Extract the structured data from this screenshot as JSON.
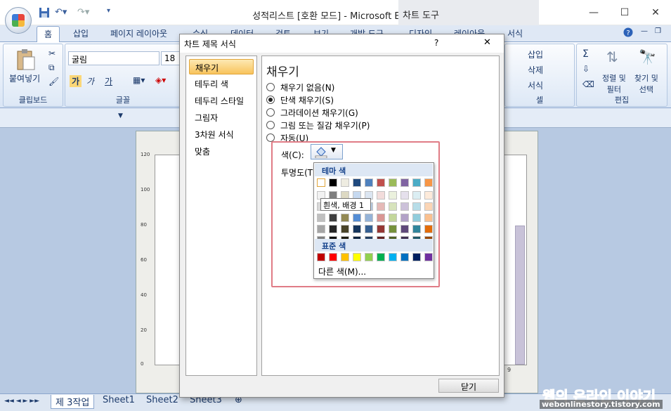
{
  "window": {
    "title": "성적리스트  [호환 모드] - Microsoft Excel",
    "chart_tools_label": "차트 도구",
    "controls": [
      "—",
      "☐",
      "✕"
    ]
  },
  "qat": {
    "more_label": "▾"
  },
  "ribbon_tabs": [
    "홈",
    "삽입",
    "페이지 레이아웃",
    "수식",
    "데이터",
    "검토",
    "보기",
    "개발 도구",
    "디자인",
    "레이아웃",
    "서식"
  ],
  "ribbon": {
    "clipboard": {
      "paste_label": "붙여넣기",
      "group_label": "클립보드"
    },
    "font": {
      "font_name": "굴림",
      "font_size": "18",
      "group_label": "글꼴",
      "bold": "가",
      "italic": "가",
      "underline": "가"
    },
    "cells": {
      "insert": "삽입",
      "delete": "삭제",
      "format": "서식",
      "group_label": "셀"
    },
    "editing": {
      "sum": "Σ",
      "sort_filter": "정렬 및\n필터",
      "find_select": "찾기 및\n선택",
      "group_label": "편집"
    }
  },
  "chart": {
    "y_ticks": [
      "120",
      "100",
      "80",
      "60",
      "40",
      "20",
      "0"
    ],
    "last_category": "9"
  },
  "sheet_tabs": [
    "제 3작업",
    "Sheet1",
    "Sheet2",
    "Sheet3"
  ],
  "dialog": {
    "title": "차트 제목 서식",
    "help": "?",
    "close_x": "✕",
    "nav_items": [
      "채우기",
      "테두리 색",
      "테두리 스타일",
      "그림자",
      "3차원 서식",
      "맞춤"
    ],
    "selected_nav": "채우기",
    "section_title": "채우기",
    "fill_options": [
      "채우기 없음(N)",
      "단색 채우기(S)",
      "그라데이션 채우기(G)",
      "그림 또는 질감 채우기(P)",
      "자동(U)"
    ],
    "selected_fill": "단색 채우기(S)",
    "color_label": "색(C):",
    "transparency_label": "투명도(T",
    "close_button": "닫기"
  },
  "palette": {
    "theme_header": "테마 색",
    "standard_header": "표준 색",
    "more_colors": "다른 색(M)...",
    "tooltip": "흰색, 배경 1",
    "theme_colors": [
      "#ffffff",
      "#000000",
      "#eeece1",
      "#1f497d",
      "#4f81bd",
      "#c0504d",
      "#9bbb59",
      "#8064a2",
      "#4bacc6",
      "#f79646"
    ],
    "theme_shades": [
      [
        "#f2f2f2",
        "#d8d8d8",
        "#bfbfbf",
        "#a5a5a5",
        "#7f7f7f"
      ],
      [
        "#7f7f7f",
        "#595959",
        "#3f3f3f",
        "#262626",
        "#0c0c0c"
      ],
      [
        "#ddd9c3",
        "#c4bd97",
        "#938953",
        "#494429",
        "#1d1b10"
      ],
      [
        "#c6d9f0",
        "#8db3e2",
        "#548dd4",
        "#17365d",
        "#0f243e"
      ],
      [
        "#dbe5f1",
        "#b8cce4",
        "#95b3d7",
        "#366092",
        "#244061"
      ],
      [
        "#f2dcdb",
        "#e5b9b7",
        "#d99694",
        "#953734",
        "#632423"
      ],
      [
        "#ebf1dd",
        "#d7e3bc",
        "#c3d69b",
        "#76923c",
        "#4f6128"
      ],
      [
        "#e5e0ec",
        "#ccc1d9",
        "#b2a2c7",
        "#5f497a",
        "#3f3151"
      ],
      [
        "#dbeef3",
        "#b7dde8",
        "#92cddc",
        "#31859b",
        "#205867"
      ],
      [
        "#fdeada",
        "#fbd5b5",
        "#fac08f",
        "#e36c09",
        "#974806"
      ]
    ],
    "standard_colors": [
      "#c00000",
      "#ff0000",
      "#ffc000",
      "#ffff00",
      "#92d050",
      "#00b050",
      "#00b0f0",
      "#0070c0",
      "#002060",
      "#7030a0"
    ]
  },
  "watermark": {
    "title": "웹의 온라인 이야기",
    "url": "webonlinestory.tistory.com"
  }
}
